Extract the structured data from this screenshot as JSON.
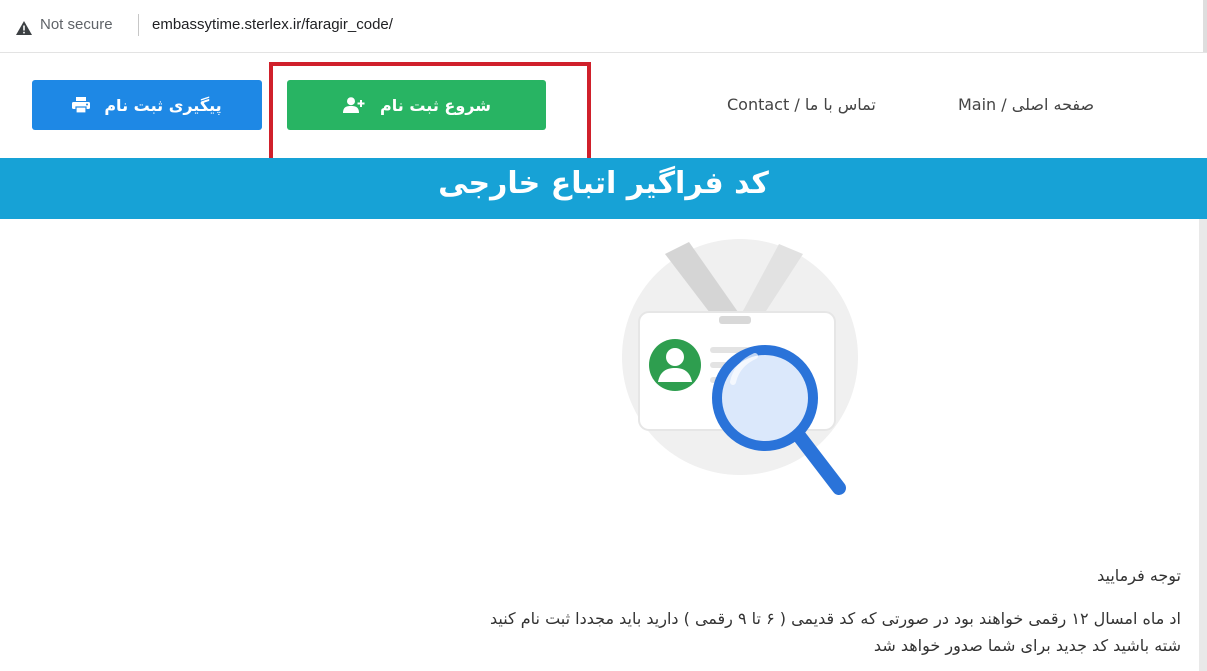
{
  "browser": {
    "security_label": "Not secure",
    "url": "embassytime.sterlex.ir/faragir_code/"
  },
  "nav": {
    "track_button": "پیگیری ثبت نام",
    "start_button": "شروع ثبت نام",
    "main_link": "صفحه اصلی / Main",
    "contact_link": "تماس با ما / Contact"
  },
  "banner": {
    "title": "کد فراگیر اتباع خارجی"
  },
  "content": {
    "line1": "توجه فرمایید",
    "line2": "اد ماه امسال ۱۲ رقمی خواهند بود در صورتی که کد قدیمی ( ۶ تا ۹ رقمی ) دارید باید مجددا ثبت نام کنید",
    "line3": "شته باشید کد جدید برای شما صدور خواهد شد"
  },
  "colors": {
    "track_button": "#1e88e5",
    "start_button": "#28b463",
    "banner": "#17a2d6",
    "highlight": "#d0202b"
  },
  "icons": {
    "warning": "warning-triangle-icon",
    "print": "printer-icon",
    "add_user": "user-plus-icon"
  }
}
